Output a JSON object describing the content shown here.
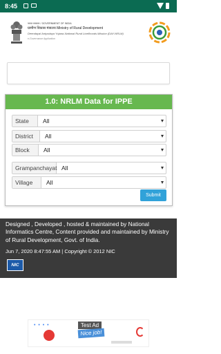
{
  "status_bar": {
    "time": "8:45"
  },
  "header": {
    "gov_line": "भारत सरकार / GOVERNMENT OF INDIA",
    "ministry": "ग्रामीण विकास मंत्रालय  Ministry of Rural Development",
    "mission": "Deendayal Antyodaya Yojana-National Rural Livelihoods Mission (DAY-NRLM)",
    "app_sub": "e-Governance Application"
  },
  "panel": {
    "title": "1.0: NRLM Data for IPPE",
    "fields": [
      {
        "label": "State",
        "value": "All"
      },
      {
        "label": "District",
        "value": "All"
      },
      {
        "label": "Block",
        "value": "All"
      },
      {
        "label": "Grampanchayat",
        "value": "All"
      },
      {
        "label": "Village",
        "value": "All"
      }
    ],
    "submit_label": "Submit"
  },
  "footer": {
    "text": "Designed , Developed , hosted & maintained by National Informatics Centre, Content provided and maintained by Ministry of Rural Development, Govt. of India.",
    "datetime": "Jun 7, 2020 8:47:55 AM | Copyright © 2012 NIC",
    "nic_logo": "NIC"
  },
  "ad": {
    "label": "Test Ad",
    "tagline": "Nice job!"
  },
  "colors": {
    "status_bar": "#0b6b52",
    "panel_header": "#67b84f",
    "submit": "#31a2d9",
    "footer": "#3a3a3a"
  }
}
